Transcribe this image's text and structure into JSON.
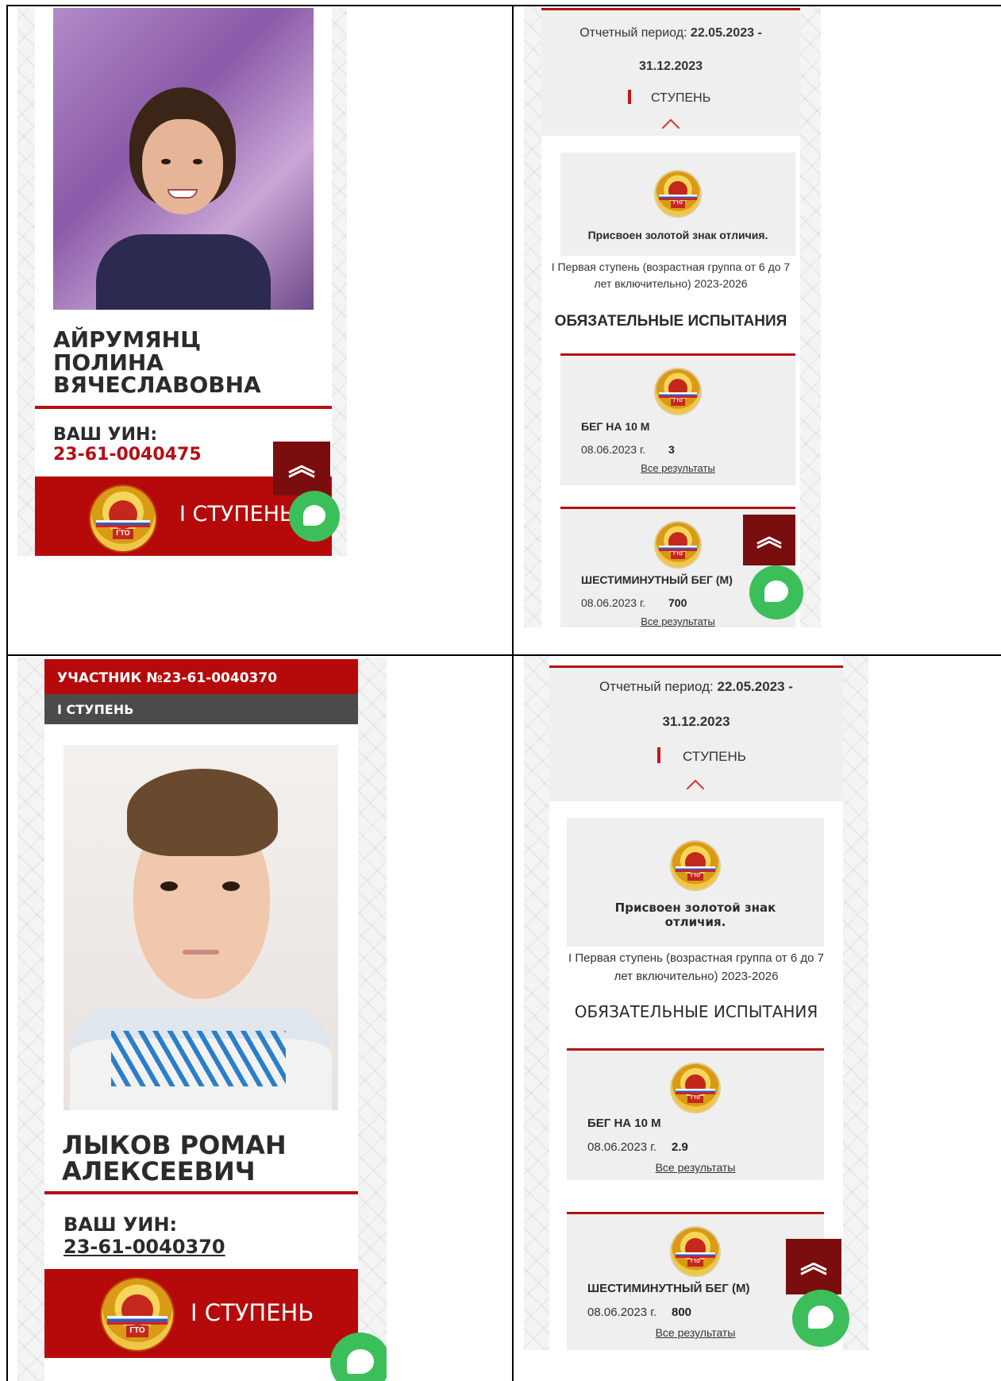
{
  "panel_a": {
    "name_lines": [
      "АЙРУМЯНЦ",
      "ПОЛИНА",
      "ВЯЧЕСЛАВОВНА"
    ],
    "uin_label": "ВАШ УИН:",
    "uin_value": "23-61-0040475",
    "stage_label": "I СТУПЕНЬ",
    "scroll_glyph": "︽",
    "badge_text": "ГТО"
  },
  "panel_b": {
    "period_label": "Отчетный период: ",
    "period_start": "22.05.2023 -",
    "period_end": "31.12.2023",
    "stage_label": "СТУПЕНЬ",
    "award_text": "Присвоен золотой знак отличия.",
    "group_text": "I Первая ступень (возрастная группа от 6 до 7 лет включительно) 2023-2026",
    "section_title": "ОБЯЗАТЕЛЬНЫЕ ИСПЫТАНИЯ",
    "tests": [
      {
        "name": "БЕГ НА 10 М",
        "date": "08.06.2023 г.",
        "value": "3",
        "link": "Все результаты"
      },
      {
        "name": "ШЕСТИМИНУТНЫЙ БЕГ (М)",
        "date": "08.06.2023 г.",
        "value": "700",
        "link": "Все результаты"
      }
    ],
    "scroll_glyph": "︽",
    "badge_text": "ГТО"
  },
  "panel_c": {
    "participant_label": "УЧАСТНИК №23-61-0040370",
    "stage_header": "I СТУПЕНЬ",
    "name_lines": [
      "ЛЫКОВ РОМАН",
      "АЛЕКСЕЕВИЧ"
    ],
    "uin_label": "ВАШ УИН:",
    "uin_value": "23-61-0040370",
    "stage_label": "I СТУПЕНЬ",
    "badge_text": "ГТО"
  },
  "panel_d": {
    "period_label": "Отчетный период: ",
    "period_start": "22.05.2023 -",
    "period_end": "31.12.2023",
    "stage_label": "СТУПЕНЬ",
    "award_text": "Присвоен золотой знак отличия.",
    "group_text": "I Первая ступень (возрастная группа от 6 до 7 лет включительно) 2023-2026",
    "section_title": "ОБЯЗАТЕЛЬНЫЕ ИСПЫТАНИЯ",
    "tests": [
      {
        "name": "БЕГ НА 10 М",
        "date": "08.06.2023 г.",
        "value": "2.9",
        "link": "Все результаты"
      },
      {
        "name": "ШЕСТИМИНУТНЫЙ БЕГ (М)",
        "date": "08.06.2023 г.",
        "value": "800",
        "link": "Все результаты"
      }
    ],
    "scroll_glyph": "︽",
    "badge_text": "ГТО"
  },
  "colors": {
    "accent_red": "#b60a0a",
    "uin_red": "#b30f14",
    "chat_green": "#3cbf5a",
    "scroll_dark_red": "#7a0d0d"
  }
}
